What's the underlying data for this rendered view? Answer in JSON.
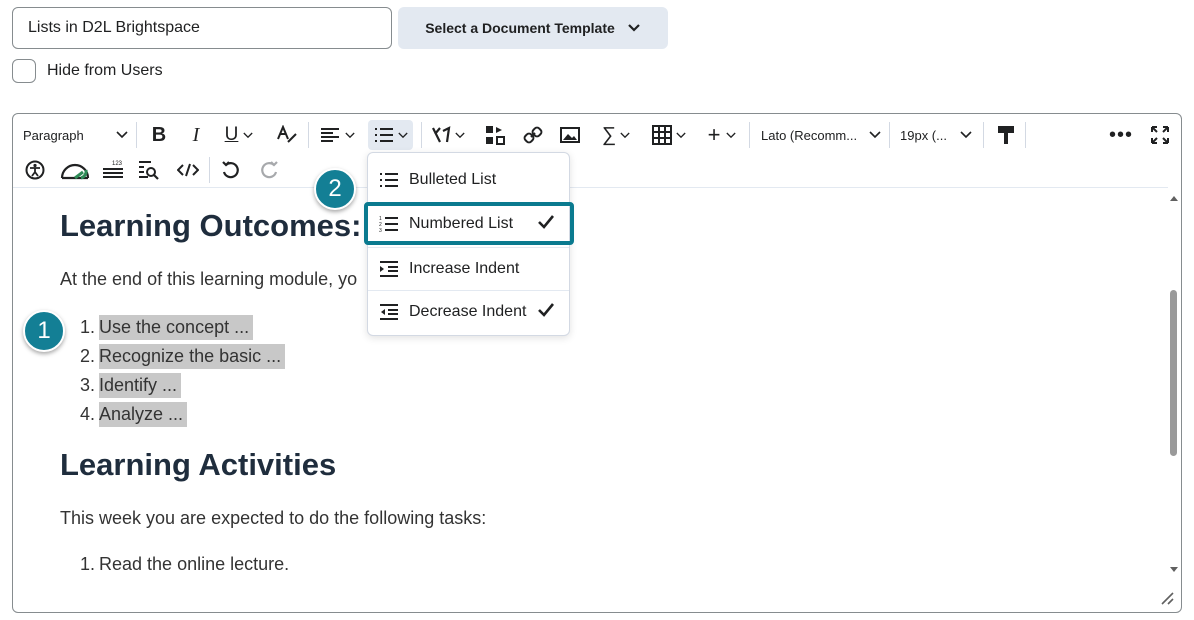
{
  "title_input": {
    "value": "Lists in D2L Brightspace"
  },
  "template_button": {
    "label": "Select a Document Template"
  },
  "hide_checkbox": {
    "label": "Hide from Users",
    "checked": false
  },
  "toolbar": {
    "block_format": "Paragraph",
    "font_family": "Lato (Recomm...",
    "font_size": "19px (..."
  },
  "list_menu": {
    "items": [
      {
        "label": "Bulleted List",
        "checked": false
      },
      {
        "label": "Numbered List",
        "checked": true
      },
      {
        "label": "Increase Indent",
        "checked": false
      },
      {
        "label": "Decrease Indent",
        "checked": true
      }
    ]
  },
  "callouts": {
    "one": "1",
    "two": "2"
  },
  "content": {
    "heading_outcomes": "Learning Outcomes:",
    "intro": "At the end of this learning module, yo",
    "outcomes": [
      {
        "num": "1.",
        "text": "Use the concept ..."
      },
      {
        "num": "2.",
        "text": "Recognize the basic ..."
      },
      {
        "num": "3.",
        "text": "Identify ..."
      },
      {
        "num": "4.",
        "text": "Analyze ..."
      }
    ],
    "heading_activities": "Learning Activities",
    "activities_intro": "This week you are expected to do the following tasks:",
    "activities": [
      {
        "num": "1.",
        "text": "Read the online lecture."
      }
    ]
  },
  "colors": {
    "accent": "#137f95",
    "focus": "#0a7a8f",
    "highlight": "#c8c8c8",
    "heading": "#1f2d3d"
  }
}
